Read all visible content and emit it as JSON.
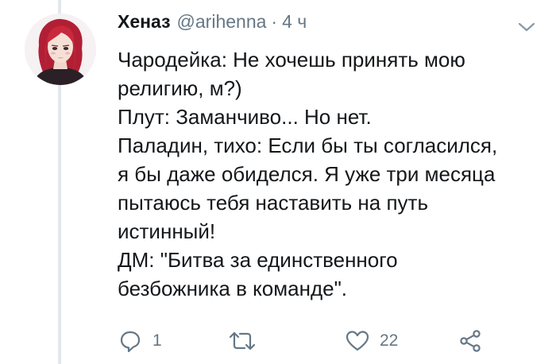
{
  "author": {
    "display_name": "Хеназ",
    "handle": "@arihenna",
    "separator": "·",
    "time": "4 ч",
    "avatar_icon": "avatar-illustration-red-haired-woman"
  },
  "tweet_text": [
    "Чародейка: Не хочешь принять мою",
    "религию, м?)",
    "Плут: Заманчиво... Но нет.",
    "Паладин, тихо: Если бы ты согласился,",
    "я бы даже обиделся. Я уже три месяца",
    "пытаюсь тебя наставить на путь",
    "истинный!",
    "ДМ: \"Битва за единственного",
    "безбожника в команде\"."
  ],
  "actions": {
    "reply": {
      "icon": "reply-icon",
      "count": "1"
    },
    "retweet": {
      "icon": "retweet-icon",
      "count": ""
    },
    "like": {
      "icon": "heart-icon",
      "count": "22"
    },
    "share": {
      "icon": "share-icon"
    }
  },
  "menu_icon": "chevron-down-icon",
  "colors": {
    "text": "#14171a",
    "secondary": "#657786",
    "thread_line": "#e1e8ed",
    "hair": "#c0283a",
    "background": "#ffffff"
  }
}
